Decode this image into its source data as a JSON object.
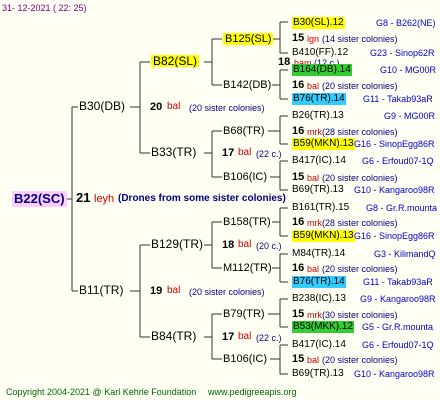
{
  "header": {
    "timestamp": "31- 12-2021 ( 22: 25)"
  },
  "root": {
    "id": "B22(SC)",
    "number": "21",
    "mating": "leyh",
    "note": "(Drones from some sister colonies)"
  },
  "gen1": [
    {
      "id": "B30(DB)",
      "number": "20",
      "mating": "bal",
      "note": "(20 sister colonies)"
    },
    {
      "id": "B11(TR)",
      "number": "19",
      "mating": "bal",
      "note": "(20 sister colonies)"
    }
  ],
  "gen2": [
    {
      "id": "B82(SL)"
    },
    {
      "id": "B33(TR)",
      "number": "17",
      "mating": "bal",
      "note": "(22 c.)"
    },
    {
      "id": "B129(TR)",
      "number": "18",
      "mating": "bal",
      "note": "(20 c.)"
    },
    {
      "id": "B84(TR)",
      "number": "17",
      "mating": "bal",
      "note": "(22 c.)"
    }
  ],
  "gen3": [
    {
      "id": "B125(SL)",
      "number": "18",
      "mating": "ham",
      "note": "(12 c.)"
    },
    {
      "id": "B142(DB)"
    },
    {
      "id": "B68(TR)",
      "number": "16",
      "mating": "mrk",
      "note": "(28 sister colonies)"
    },
    {
      "id": "B106(IC)",
      "number": "15",
      "mating": "bal",
      "note": "(20 sister colonies)"
    },
    {
      "id": "B158(TR)",
      "number": "16",
      "mating": "mrk",
      "note": "(28 sister colonies)"
    },
    {
      "id": "M112(TR)",
      "number": "16",
      "mating": "bal",
      "note": "(20 sister colonies)"
    },
    {
      "id": "B79(TR)",
      "number": "15",
      "mating": "mrk",
      "note": "(30 sister colonies)"
    },
    {
      "id": "B106(IC)",
      "number": "15",
      "mating": "bal",
      "note": "(20 sister colonies)"
    }
  ],
  "gen4": [
    {
      "id": "B30(SL).12",
      "source": "G8 - B262(NE)"
    },
    {
      "id": "B410(FF).12",
      "source": "G23 - Sinop62R"
    },
    {
      "id": "B164(DB).14",
      "source": "G10 - MG00R"
    },
    {
      "id": "B76(TR).14",
      "source": "G11 - Takab93aR"
    },
    {
      "id": "B26(TR).13",
      "source": "G9 - MG00R"
    },
    {
      "id": "B59(MKN).13",
      "source": "G16 - SinopEgg86R"
    },
    {
      "id": "B417(IC).14",
      "source": "G6 - Erfoud07-1Q"
    },
    {
      "id": "B69(TR).13",
      "source": "G10 - Kangaroo98R"
    },
    {
      "id": "B161(TR).15",
      "source": "G8 - Gr.R.mounta"
    },
    {
      "id": "B59(MKN).13",
      "source": "G16 - SinopEgg86R"
    },
    {
      "id": "M84(TR).14",
      "source": "G3 - KilimandQ"
    },
    {
      "id": "B76(TR).14",
      "source": "G11 - Takab93aR"
    },
    {
      "id": "B238(IC).13",
      "source": "G9 - Kangaroo98R"
    },
    {
      "id": "B53(MKK).12",
      "source": "G5 - Gr.R.mounta"
    },
    {
      "id": "B417(IC).14",
      "source": "G6 - Erfoud07-1Q"
    },
    {
      "id": "B69(TR).13",
      "source": "G10 - Kangaroo98R"
    }
  ],
  "gen3_summary": {
    "first": {
      "number": "15",
      "mating": "lgn",
      "note": "(14 sister colonies)"
    },
    "second": {
      "number": "16",
      "mating": "bal",
      "note": "(20 sister colonies)"
    }
  },
  "footer": {
    "copyright": "Copyright 2004-2021 @ Karl Kehrle Foundation",
    "url": "www.pedigreeapis.org"
  },
  "colors": {
    "background": "#fffff3",
    "highlight_yellow": "#ffff00",
    "highlight_green": "#33cc33",
    "highlight_cyan": "#33ccff",
    "root_bg": "#ffccff",
    "line": "#333333"
  }
}
